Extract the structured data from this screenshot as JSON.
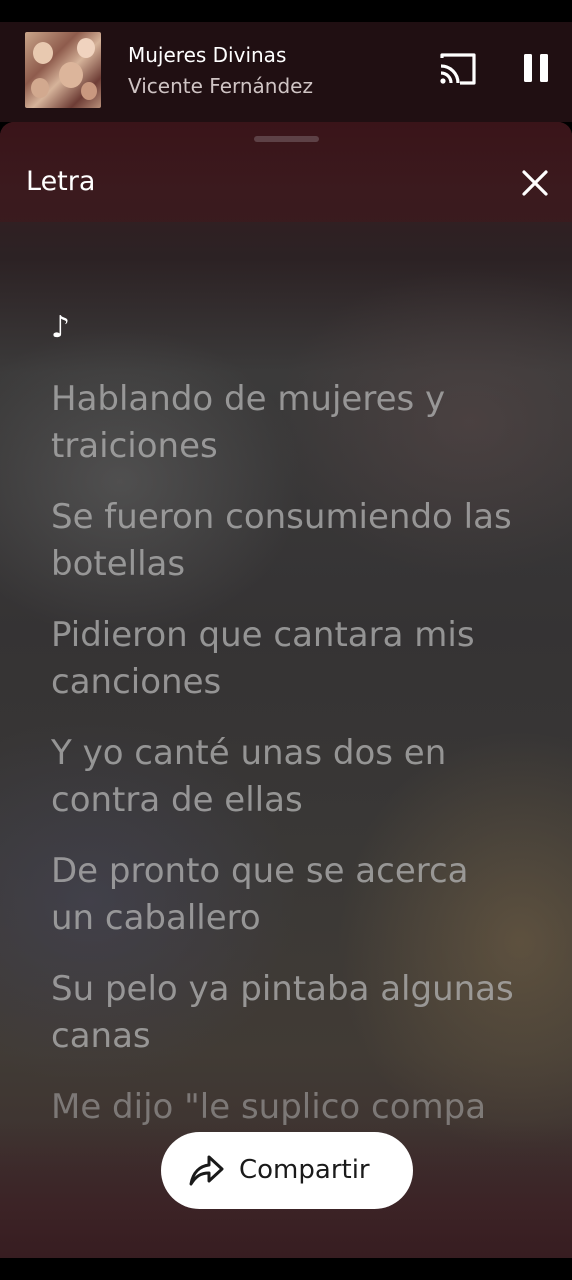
{
  "player": {
    "track_title": "Mujeres Divinas",
    "artist": "Vicente Fernández",
    "album_art_icon": "album-cover",
    "cast_icon": "cast-icon",
    "pause_icon": "pause-icon"
  },
  "sheet": {
    "title": "Letra",
    "close_icon": "close-icon",
    "note_symbol": "♪",
    "lyrics": [
      "Hablando de mujeres y traiciones",
      "Se fueron consumiendo las botellas",
      "Pidieron que cantara mis canciones",
      "Y yo canté unas dos en contra de ellas",
      "De pronto que se acerca un caballero",
      "Su pelo ya pintaba algunas canas",
      "Me dijo \"le suplico compa"
    ]
  },
  "share": {
    "label": "Compartir",
    "icon": "share-icon"
  },
  "colors": {
    "header_bg": "#200f12",
    "sheet_header_bg": "#3b1a1e",
    "share_bg": "#ffffff"
  }
}
